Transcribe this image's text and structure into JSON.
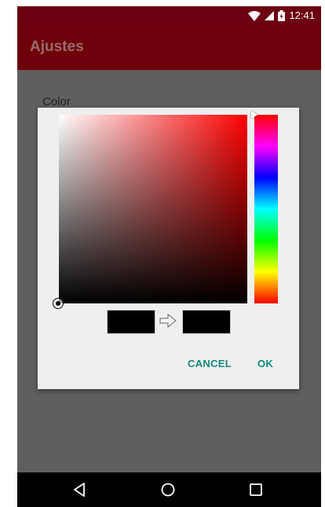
{
  "status_bar": {
    "time": "12:41",
    "icons": [
      "wifi-icon",
      "signal-icon",
      "battery-icon"
    ]
  },
  "app_bar": {
    "title": "Ajustes"
  },
  "preference": {
    "label": "Color"
  },
  "color_picker": {
    "hue_color": "#ff0000",
    "old_color": "#000000",
    "new_color": "#000000",
    "cancel_label": "CANCEL",
    "ok_label": "OK"
  },
  "nav_bar": {
    "buttons": [
      "back-icon",
      "home-icon",
      "recents-icon"
    ]
  },
  "colors": {
    "status_bar": "#6b0010",
    "app_bar": "#6d0008",
    "dialog_bg": "#efefef",
    "accent": "#13887c",
    "scrim": "#5f5f5f"
  }
}
